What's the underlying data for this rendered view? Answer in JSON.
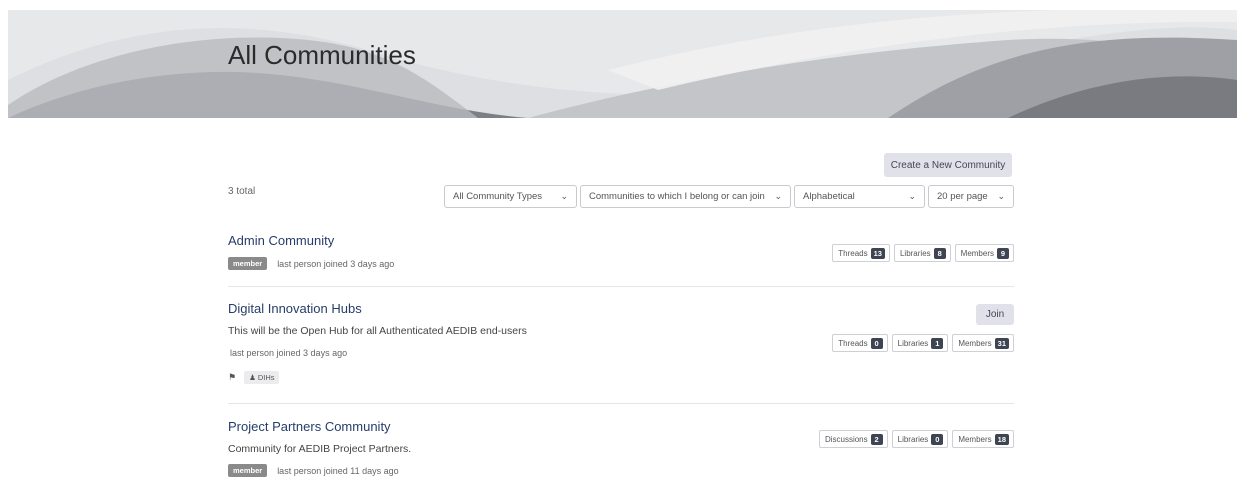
{
  "header": {
    "title": "All Communities"
  },
  "toolbar": {
    "create_label": "Create a New Community",
    "total": "3 total",
    "filters": {
      "type": "All Community Types",
      "membership": "Communities to which I belong or can join",
      "sort": "Alphabetical",
      "per_page": "20 per page"
    }
  },
  "communities": [
    {
      "title": "Admin Community",
      "badge": "member",
      "last_joined": "last person joined 3 days ago",
      "stats": [
        {
          "label": "Threads",
          "count": "13"
        },
        {
          "label": "Libraries",
          "count": "8"
        },
        {
          "label": "Members",
          "count": "9"
        }
      ]
    },
    {
      "title": "Digital Innovation Hubs",
      "description": "This will be the Open Hub for all Authenticated AEDIB end-users",
      "last_joined": "last person joined 3 days ago",
      "join_label": "Join",
      "tag": "DIHs",
      "stats": [
        {
          "label": "Threads",
          "count": "0"
        },
        {
          "label": "Libraries",
          "count": "1"
        },
        {
          "label": "Members",
          "count": "31"
        }
      ]
    },
    {
      "title": "Project Partners Community",
      "description": "Community for AEDIB Project Partners.",
      "badge": "member",
      "last_joined": "last person joined 11 days ago",
      "stats": [
        {
          "label": "Discussions",
          "count": "2"
        },
        {
          "label": "Libraries",
          "count": "0"
        },
        {
          "label": "Members",
          "count": "18"
        }
      ]
    }
  ]
}
